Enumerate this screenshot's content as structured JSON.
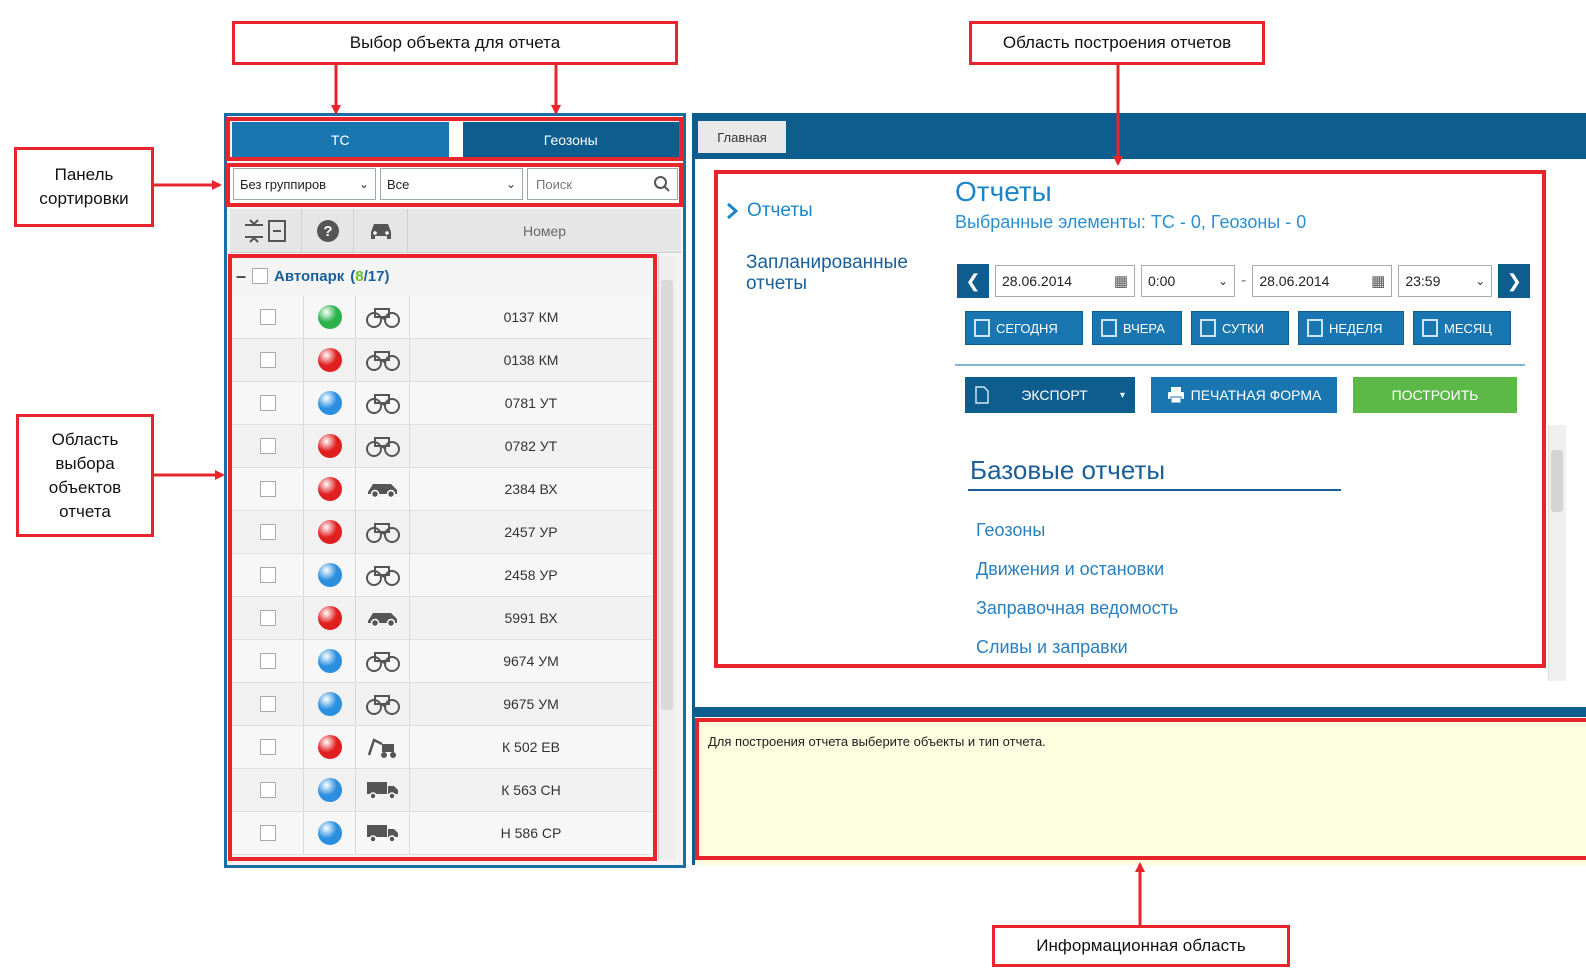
{
  "annotations": {
    "object_selection": "Выбор объекта для отчета",
    "report_area": "Область построения отчетов",
    "sort_panel": "Панель сортировки",
    "object_area": "Область выбора объектов отчета",
    "info_area": "Информационная область"
  },
  "object_tabs": {
    "tc": "ТС",
    "geozones": "Геозоны"
  },
  "sort_panel": {
    "grouping_value": "Без группиров",
    "filter_value": "Все",
    "search_placeholder": "Поиск"
  },
  "list_header": {
    "number": "Номер"
  },
  "group": {
    "name": "Автопарк",
    "selected": "8",
    "total": "/17"
  },
  "vehicles": [
    {
      "plate": "0137 КМ",
      "status": "green",
      "icon": "tractor-icon"
    },
    {
      "plate": "0138 КМ",
      "status": "red",
      "icon": "tractor-icon"
    },
    {
      "plate": "0781 УТ",
      "status": "blue",
      "icon": "tractor-icon"
    },
    {
      "plate": "0782 УТ",
      "status": "red",
      "icon": "tractor-icon"
    },
    {
      "plate": "2384 ВХ",
      "status": "red",
      "icon": "car-icon"
    },
    {
      "plate": "2457 УР",
      "status": "red",
      "icon": "tractor-icon"
    },
    {
      "plate": "2458 УР",
      "status": "blue",
      "icon": "tractor-icon"
    },
    {
      "plate": "5991 ВХ",
      "status": "red",
      "icon": "car-icon"
    },
    {
      "plate": "9674 УМ",
      "status": "blue",
      "icon": "tractor-icon"
    },
    {
      "plate": "9675 УМ",
      "status": "blue",
      "icon": "tractor-icon"
    },
    {
      "plate": "К 502 ЕВ",
      "status": "red",
      "icon": "excavator-icon"
    },
    {
      "plate": "К 563 СН",
      "status": "blue",
      "icon": "truck-icon"
    },
    {
      "plate": "Н 586 СР",
      "status": "blue",
      "icon": "truck-icon"
    }
  ],
  "status_colors": {
    "green": "#2bb24c",
    "red": "#e02020",
    "blue": "#2b8fe0"
  },
  "right_panel": {
    "main_tab": "Главная",
    "nav_reports": "Отчеты",
    "nav_scheduled": "Запланированные отчеты",
    "title": "Отчеты",
    "subtitle": "Выбранные элементы: ТС - 0, Геозоны - 0",
    "date_from": "28.06.2014",
    "time_from": "0:00",
    "dash": "-",
    "date_to": "28.06.2014",
    "time_to": "23:59",
    "periods": [
      "СЕГОДНЯ",
      "ВЧЕРА",
      "СУТКИ",
      "НЕДЕЛЯ",
      "МЕСЯЦ"
    ],
    "export_label": "ЭКСПОРТ",
    "print_label": "ПЕЧАТНАЯ ФОРМА",
    "build_label": "ПОСТРОИТЬ",
    "base_reports_title": "Базовые отчеты",
    "base_reports": [
      "Геозоны",
      "Движения и остановки",
      "Заправочная ведомость",
      "Сливы и заправки"
    ]
  },
  "info_text": "Для построения отчета выберите объекты и тип отчета."
}
